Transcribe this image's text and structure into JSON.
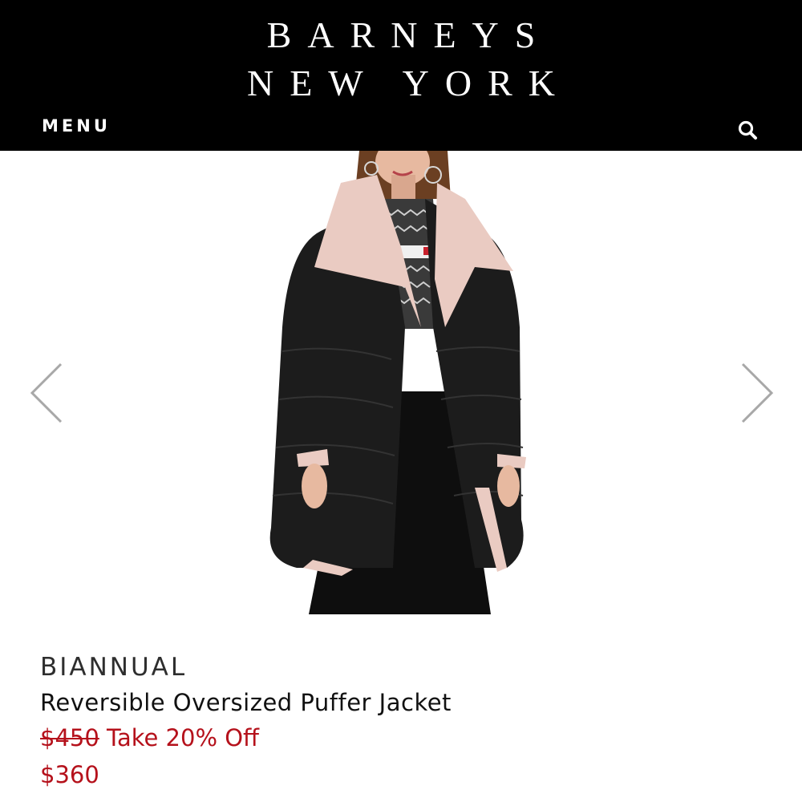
{
  "header": {
    "logo_line1": "BARNEYS",
    "logo_line2": "NEW YORK",
    "menu_label": "MENU",
    "icons": {
      "search": "search-icon"
    }
  },
  "carousel": {
    "prev_icon": "chevron-left-icon",
    "next_icon": "chevron-right-icon"
  },
  "product": {
    "brand": "BIANNUAL",
    "name": "Reversible Oversized Puffer Jacket",
    "original_price": "$450",
    "promo": "Take 20% Off",
    "sale_price": "$360"
  },
  "colors": {
    "header_bg": "#000000",
    "sale_red": "#b5111b",
    "jacket_black": "#1c1c1c",
    "lining_pink": "#eacbc2"
  }
}
